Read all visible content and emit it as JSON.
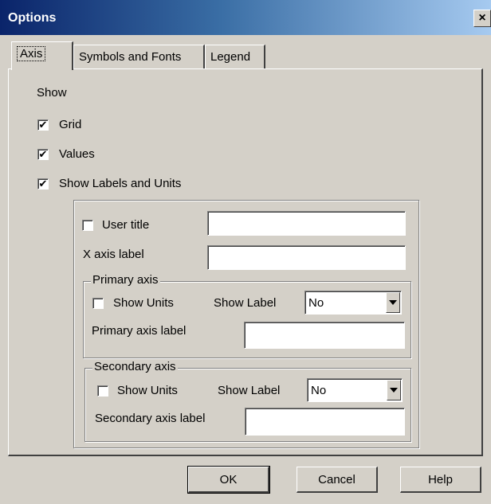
{
  "window": {
    "title": "Options",
    "close_glyph": "×"
  },
  "tabs": [
    {
      "label": "Axis",
      "active": true
    },
    {
      "label": "Symbols and Fonts",
      "active": false
    },
    {
      "label": "Legend",
      "active": false
    }
  ],
  "show_section": {
    "heading": "Show",
    "grid": {
      "label": "Grid",
      "checked": true
    },
    "values": {
      "label": "Values",
      "checked": true
    },
    "labels_units": {
      "label": "Show Labels and Units",
      "checked": true
    }
  },
  "labels_group": {
    "user_title": {
      "label": "User title",
      "checked": false,
      "value": ""
    },
    "x_axis_label": {
      "label": "X axis label",
      "value": ""
    },
    "primary_axis": {
      "title": "Primary axis",
      "show_units": {
        "label": "Show Units",
        "checked": false
      },
      "show_label": {
        "label": "Show Label",
        "selected": "No"
      },
      "axis_label": {
        "label": "Primary axis label",
        "value": ""
      }
    },
    "secondary_axis": {
      "title": "Secondary axis",
      "show_units": {
        "label": "Show Units",
        "checked": false
      },
      "show_label": {
        "label": "Show Label",
        "selected": "No"
      },
      "axis_label": {
        "label": "Secondary axis label",
        "value": ""
      }
    }
  },
  "buttons": {
    "ok": "OK",
    "cancel": "Cancel",
    "help": "Help"
  },
  "check_glyph": "✔"
}
